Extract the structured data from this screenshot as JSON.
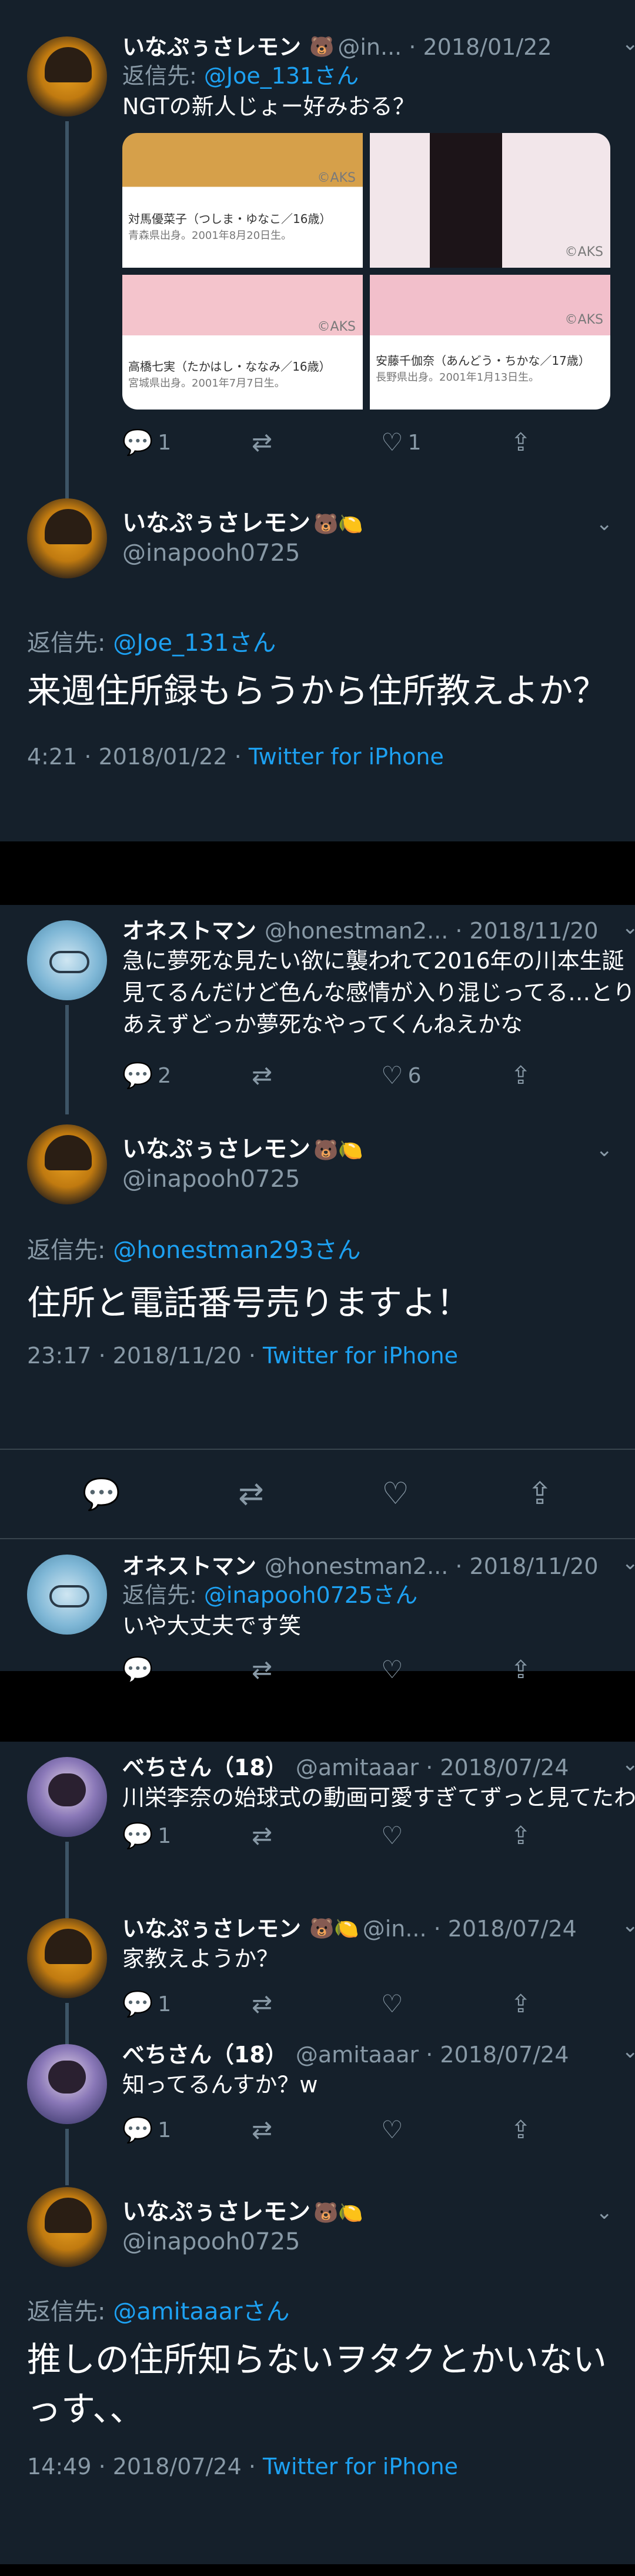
{
  "media_cells": [
    {
      "tag": "©AKS",
      "title": "対馬優菜子（つしま・ゆなこ／16歳）",
      "sub": "青森県出身。2001年8月20日生。"
    },
    {
      "tag": "©AKS",
      "title": "",
      "sub": ""
    },
    {
      "tag": "©AKS",
      "title": "高橋七実（たかはし・ななみ／16歳）",
      "sub": "宮城県出身。2001年7月7日生。"
    },
    {
      "tag": "©AKS",
      "title": "安藤千伽奈（あんどう・ちかな／17歳）",
      "sub": "長野県出身。2001年1月13日生。"
    }
  ],
  "thread1": {
    "reply": {
      "name": "いなぷぅさレモン",
      "emoji": "🐻",
      "handle": "@in... · 2018/01/22",
      "reply_prefix": "返信先: ",
      "reply_to": "@Joe_131さん",
      "text": "NGTの新人じょー好みおる？",
      "replies": "1",
      "retweets": "",
      "likes": "1"
    },
    "focus": {
      "name": "いなぷぅさレモン",
      "emoji": "🐻🍋",
      "handle": "@inapooh0725",
      "reply_prefix": "返信先: ",
      "reply_to": "@Joe_131さん",
      "text": "来週住所録もらうから住所教えよか？",
      "time": "4:21 · 2018/01/22 · ",
      "client": "Twitter for iPhone"
    }
  },
  "thread2": {
    "parent": {
      "name": "オネストマン",
      "handle": "@honestman2... · 2018/11/20",
      "text": "急に夢死な見たい欲に襲われて2016年の川本生誕見てるんだけど色んな感情が入り混じってる…とりあえずどっか夢死なやってくんねえかな",
      "replies": "2",
      "retweets": "",
      "likes": "6"
    },
    "focus": {
      "name": "いなぷぅさレモン",
      "emoji": "🐻🍋",
      "handle": "@inapooh0725",
      "reply_prefix": "返信先: ",
      "reply_to": "@honestman293さん",
      "text": "住所と電話番号売りますよ！",
      "time": "23:17 · 2018/11/20 · ",
      "client": "Twitter for iPhone"
    },
    "child": {
      "name": "オネストマン",
      "handle": "@honestman2... · 2018/11/20",
      "reply_prefix": "返信先: ",
      "reply_to": "@inapooh0725さん",
      "text": "いや大丈夫です笑"
    }
  },
  "thread3": {
    "t1": {
      "name": "べちさん（18）",
      "handle": "@amitaaar · 2018/07/24",
      "text": "川栄李奈の始球式の動画可愛すぎてずっと見てたわ",
      "replies": "1"
    },
    "t2": {
      "name": "いなぷぅさレモン",
      "emoji": "🐻🍋",
      "handle": "@in... · 2018/07/24",
      "text": "家教えようか？",
      "replies": "1"
    },
    "t3": {
      "name": "べちさん（18）",
      "handle": "@amitaaar · 2018/07/24",
      "text": "知ってるんすか？w",
      "replies": "1"
    },
    "focus": {
      "name": "いなぷぅさレモン",
      "emoji": "🐻🍋",
      "handle": "@inapooh0725",
      "reply_prefix": "返信先: ",
      "reply_to": "@amitaaarさん",
      "text": "推しの住所知らないヲタクとかいないっす、、",
      "time": "14:49 · 2018/07/24 · ",
      "client": "Twitter for iPhone"
    }
  },
  "icons": {
    "reply": "💬",
    "retweet": "⇄",
    "like": "♡",
    "share": "⇪",
    "chevron": "⌄"
  },
  "colors": {
    "background": "#15202b",
    "accent": "#1da1f2",
    "muted": "#8899a6",
    "separator": "#000000"
  }
}
